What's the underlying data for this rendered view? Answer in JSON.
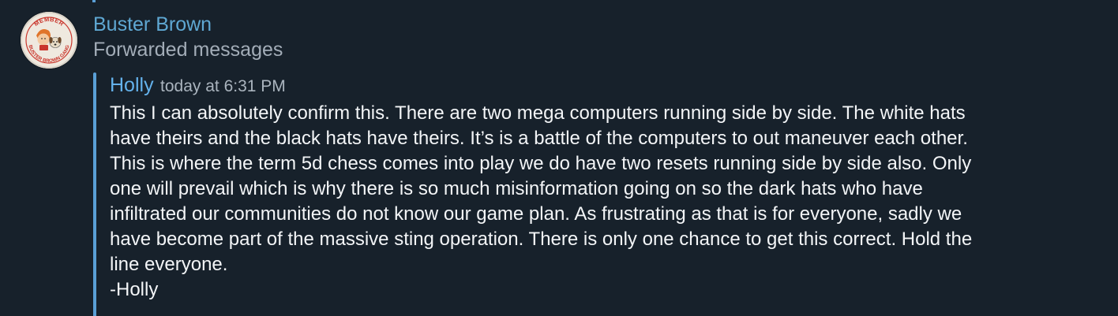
{
  "message": {
    "sender_name": "Buster Brown",
    "forward_label": "Forwarded messages",
    "avatar": {
      "icon": "buster-brown-member-badge",
      "badge_text_top": "MEMBER",
      "badge_text_bottom": "BUSTER BROWN GANG"
    },
    "forwarded": {
      "author": "Holly",
      "timestamp": "today at 6:31 PM",
      "lines": [
        "This I can absolutely confirm this. There are two mega computers running side by side. The white hats",
        "have theirs and the black hats have theirs. It’s is a battle of the computers to out maneuver each other.",
        "This is where the term 5d chess comes into play we do have two resets running side by side also. Only",
        "one will prevail which is why there is so much misinformation going on so the dark hats who have",
        "infiltrated our communities do not know our game plan. As frustrating as that is for everyone, sadly we",
        "have become part of the massive sting operation. There is only one chance to get this correct. Hold the",
        "line everyone.",
        "-Holly"
      ]
    }
  },
  "colors": {
    "background": "#17212b",
    "sender": "#5fa8d3",
    "forward_label": "#a3adb8",
    "quote_bar": "#5a9fd6",
    "author": "#64b2ec",
    "timestamp": "#aab4be",
    "text": "#f3f5f7"
  }
}
